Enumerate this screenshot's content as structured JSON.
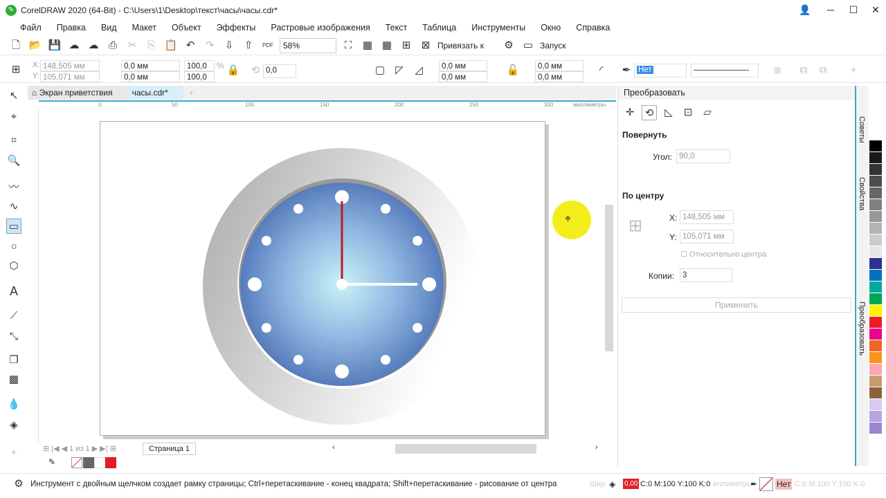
{
  "title": "CorelDRAW 2020 (64-Bit) - C:\\Users\\1\\Desktop\\текст\\часы\\часы.cdr*",
  "menu": [
    "Файл",
    "Правка",
    "Вид",
    "Макет",
    "Объект",
    "Эффекты",
    "Растровые изображения",
    "Текст",
    "Таблица",
    "Инструменты",
    "Окно",
    "Справка"
  ],
  "toolbar": {
    "zoom": "58%",
    "snap": "Привязать к",
    "launch": "Запуск",
    "pdf": "PDF"
  },
  "props": {
    "x": "148,505 мм",
    "y": "105,071 мм",
    "w": "0,0 мм",
    "h": "0,0 мм",
    "sx": "100,0",
    "sy": "100,0",
    "pct": "%",
    "angle": "0,0",
    "c1": "0,0 мм",
    "c2": "0,0 мм",
    "c3": "0,0 мм",
    "c4": "0,0 мм",
    "outline": "Нет",
    "xl": "X:",
    "yl": "Y:"
  },
  "tabs": [
    "Экран приветствия",
    "часы.cdr*"
  ],
  "ruler": {
    "ticks": [
      "0",
      "50",
      "100",
      "150",
      "200",
      "250",
      "300"
    ],
    "unit": "миллиметры"
  },
  "docker": {
    "title": "Преобразовать",
    "rotate": "Повернуть",
    "angle_label": "Угол:",
    "angle": "90,0",
    "center": "По центру",
    "x_label": "X:",
    "x": "148,505 мм",
    "y_label": "Y:",
    "y": "105,071 мм",
    "relative": "Относительно центра",
    "copies_label": "Копии:",
    "copies": "3",
    "apply": "Применить"
  },
  "side_tabs": [
    "Советы",
    "Свойства",
    "Преобразовать"
  ],
  "palette": [
    "#ffffff",
    "#000000",
    "#1a1a1a",
    "#333333",
    "#4d4d4d",
    "#666666",
    "#808080",
    "#999999",
    "#b3b3b3",
    "#cccccc",
    "#e6e6e6",
    "#2e3192",
    "#0072bc",
    "#00a99d",
    "#00a651",
    "#fff200",
    "#ed1c24",
    "#ec008c",
    "#f26522",
    "#f7941d",
    "#f9a7b0",
    "#c69c6d",
    "#8c6239",
    "#d9c9f0",
    "#b5a6e0",
    "#9b86d0"
  ],
  "pagebar": {
    "nav": "1 из 1",
    "page": "Страница 1"
  },
  "status": {
    "hint": "Инструмент с двойным щелчком создает рамку страницы; Ctrl+перетаскивание - конец квадрата; Shift+перетаскивание - рисование от центра",
    "fill_val": "0,00",
    "fill": "C:0 M:100 Y:100 K:0",
    "outline": "Нет",
    "outline_cmyk": "C:0 M:100 Y:100 K:0",
    "width_label": "Шир",
    "units": "иллиметры"
  },
  "colors": {
    "accent": "#3aa7c8",
    "fill": "#e31e24"
  }
}
